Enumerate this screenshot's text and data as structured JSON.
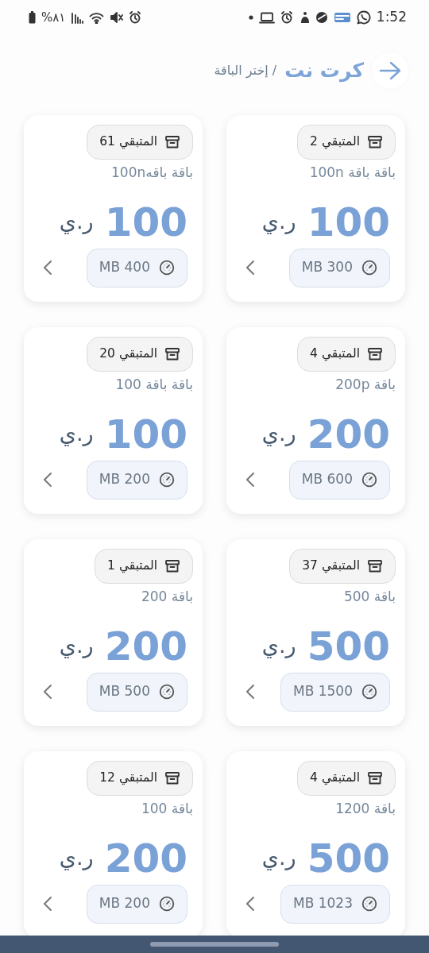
{
  "status_bar": {
    "time": "1:52",
    "battery": "%٨١"
  },
  "header": {
    "title": "كرت نت",
    "subtitle": "/ إختر الباقة"
  },
  "packages": [
    {
      "remaining": "المتبقي 2",
      "name": "باقة باقة 100n",
      "price": "100",
      "currency": "ر.ي",
      "data": "MB 300"
    },
    {
      "remaining": "المتبقي 61",
      "name": "باقة باقه100n",
      "price": "100",
      "currency": "ر.ي",
      "data": "MB 400"
    },
    {
      "remaining": "المتبقي 4",
      "name": "باقة 200p",
      "price": "200",
      "currency": "ر.ي",
      "data": "MB 600"
    },
    {
      "remaining": "المتبقي 20",
      "name": "باقة باقة 100",
      "price": "100",
      "currency": "ر.ي",
      "data": "MB 200"
    },
    {
      "remaining": "المتبقي 37",
      "name": "باقة 500",
      "price": "500",
      "currency": "ر.ي",
      "data": "MB 1500"
    },
    {
      "remaining": "المتبقي 1",
      "name": "باقة 200",
      "price": "200",
      "currency": "ر.ي",
      "data": "MB 500"
    },
    {
      "remaining": "المتبقي 4",
      "name": "باقة 1200",
      "price": "500",
      "currency": "ر.ي",
      "data": "MB 1023"
    },
    {
      "remaining": "المتبقي 12",
      "name": "باقة 100",
      "price": "200",
      "currency": "ر.ي",
      "data": "MB 200"
    }
  ]
}
